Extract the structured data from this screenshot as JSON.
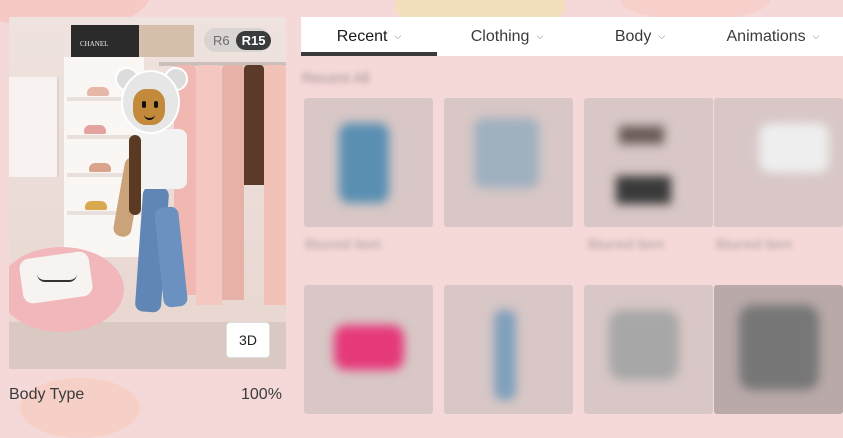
{
  "avatar_panel": {
    "rig_options": [
      "R6",
      "R15"
    ],
    "rig_selected": "R15",
    "view_3d_label": "3D",
    "shelf_box_brand": "CHANEL",
    "body_type_label": "Body Type",
    "body_type_value": "100%"
  },
  "tabs": [
    {
      "label": "Recent",
      "active": true
    },
    {
      "label": "Clothing",
      "active": false
    },
    {
      "label": "Body",
      "active": false
    },
    {
      "label": "Animations",
      "active": false
    }
  ],
  "section_label": "Recent All",
  "items_row1": [
    {
      "caption": "Blurred Item",
      "color": "#5a8fb2"
    },
    {
      "caption": "",
      "color": "#9fb0bf"
    },
    {
      "caption": "Blurred Item",
      "color": "#3a3a3a"
    },
    {
      "caption": "Blurred Item",
      "color": "#e8e8e8"
    }
  ],
  "items_row2": [
    {
      "color": "#e5397a"
    },
    {
      "color": "#7fa0bb"
    },
    {
      "color": "#a7a7a7"
    },
    {
      "color": "#777777"
    }
  ],
  "colors": {
    "background": "#f5d9d8",
    "tab_active_underline": "#393b3d",
    "text_primary": "#393b3d"
  }
}
